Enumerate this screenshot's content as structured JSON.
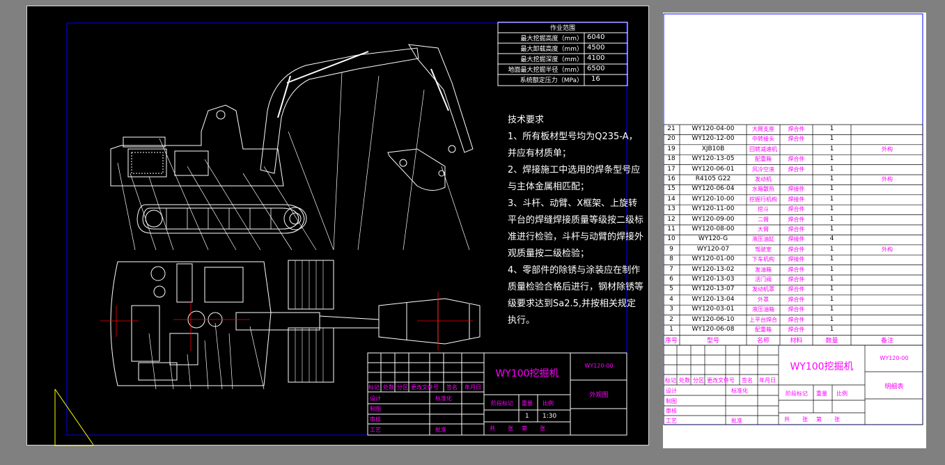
{
  "left_sheet": {
    "spec_table": {
      "title": "作业范围",
      "rows": [
        {
          "label": "最大挖掘高度（mm）",
          "value": "6040"
        },
        {
          "label": "最大卸载高度（mm）",
          "value": "4500"
        },
        {
          "label": "最大挖掘深度（mm）",
          "value": "4100"
        },
        {
          "label": "地面最大挖掘半径（mm）",
          "value": "6500"
        },
        {
          "label": "系统额定压力（MPa）",
          "value": "16"
        }
      ]
    },
    "tech_requirements": {
      "title": "技术要求",
      "lines": [
        "1、所有板材型号均为Q235-A，",
        "并应有材质单；",
        "2、焊接施工中选用的焊条型号应",
        "与主体金属相匹配；",
        "3、斗杆、动臂、X框架、上旋转",
        "平台的焊缝焊接质量等级按二级标",
        "准进行检验，斗杆与动臂的焊接外",
        "观质量按二级检验；",
        "4、零部件的除锈与涂装应在制作",
        "质量检验合格后进行，钢材除锈等",
        "级要求达到Sa2.5,并按相关规定",
        "执行。"
      ]
    },
    "title_block": {
      "product_name": "WY100挖掘机",
      "drawing_no": "WY120-00",
      "drawing_name": "外观图",
      "labels": {
        "mark": "标记",
        "count": "处数",
        "zone": "分区",
        "doc_no": "更改文件号",
        "sign": "签名",
        "date": "年月日",
        "design": "设计",
        "std": "标准化",
        "draw": "制图",
        "check": "审核",
        "process": "工艺",
        "approve": "批准",
        "stage_mark": "阶段标记",
        "weight": "重量",
        "scale": "比例",
        "total": "共",
        "sheets": "张",
        "sheet_no": "第",
        "sheet_unit": "张"
      },
      "qty": "1",
      "scale_value": "1:30"
    }
  },
  "right_sheet": {
    "bom": {
      "columns": [
        "序号",
        "型号",
        "名称",
        "材料",
        "数量",
        "备注"
      ],
      "rows": [
        [
          "21",
          "WY120-04-00",
          "大臂支座",
          "焊合件",
          "1",
          ""
        ],
        [
          "20",
          "WY120-12-00",
          "中转接头",
          "焊合件",
          "1",
          ""
        ],
        [
          "19",
          "XJB10B",
          "回转减速机",
          "",
          "1",
          "外构"
        ],
        [
          "18",
          "WY120-13-05",
          "配重箱",
          "焊合件",
          "1",
          ""
        ],
        [
          "17",
          "WY120-06-01",
          "风冷空液",
          "焊合件",
          "1",
          ""
        ],
        [
          "16",
          "R4105 G22",
          "发动机",
          "",
          "1",
          "外构"
        ],
        [
          "15",
          "WY120-06-04",
          "水箱散热",
          "焊接件",
          "1",
          ""
        ],
        [
          "14",
          "WY120-10-00",
          "挖掘行机构",
          "焊接件",
          "1",
          ""
        ],
        [
          "13",
          "WY120-11-00",
          "挖斗",
          "焊合件",
          "1",
          ""
        ],
        [
          "12",
          "WY120-09-00",
          "二臂",
          "焊合件",
          "1",
          ""
        ],
        [
          "11",
          "WY120-08-00",
          "大臂",
          "焊合件",
          "1",
          ""
        ],
        [
          "10",
          "WY120-G",
          "液压油缸",
          "焊接件",
          "4",
          ""
        ],
        [
          "9",
          "WY120-07",
          "驾驶室",
          "焊合件",
          "1",
          "外构"
        ],
        [
          "8",
          "WY120-01-00",
          "下车机构",
          "焊接件",
          "1",
          ""
        ],
        [
          "7",
          "WY120-13-02",
          "发油箱",
          "焊合件",
          "1",
          ""
        ],
        [
          "6",
          "WY120-13-03",
          "活门阀",
          "焊合件",
          "1",
          ""
        ],
        [
          "5",
          "WY120-13-07",
          "发动机罩",
          "焊合件",
          "1",
          ""
        ],
        [
          "4",
          "WY120-13-04",
          "外罩",
          "焊合件",
          "1",
          ""
        ],
        [
          "3",
          "WY120-03-01",
          "液压油箱",
          "焊合件",
          "1",
          ""
        ],
        [
          "2",
          "WY120-06-10",
          "上平台焊合",
          "焊合件",
          "1",
          ""
        ],
        [
          "1",
          "WY120-06-08",
          "配重箱",
          "焊合件",
          "1",
          ""
        ]
      ]
    },
    "title_block": {
      "product_name": "WY100挖掘机",
      "drawing_no": "WY120-00",
      "drawing_name": "明细表",
      "labels": {
        "mark": "标记",
        "count": "处数",
        "zone": "分区",
        "doc_no": "更改文件号",
        "sign": "签名",
        "date": "年月日",
        "design": "设计",
        "std": "标准化",
        "draw": "制图",
        "check": "审核",
        "process": "工艺",
        "approve": "批准",
        "stage_mark": "阶段标记",
        "weight": "重量",
        "scale": "比例",
        "total": "共",
        "sheets": "张",
        "sheet_no": "第",
        "sheet_unit": "张"
      }
    }
  },
  "colors": {
    "background": "#808080",
    "sheet": "#000000",
    "line": "#ffffff",
    "frame": "#0000ff",
    "text_magenta": "#ff00ff",
    "center": "#ff0000"
  }
}
